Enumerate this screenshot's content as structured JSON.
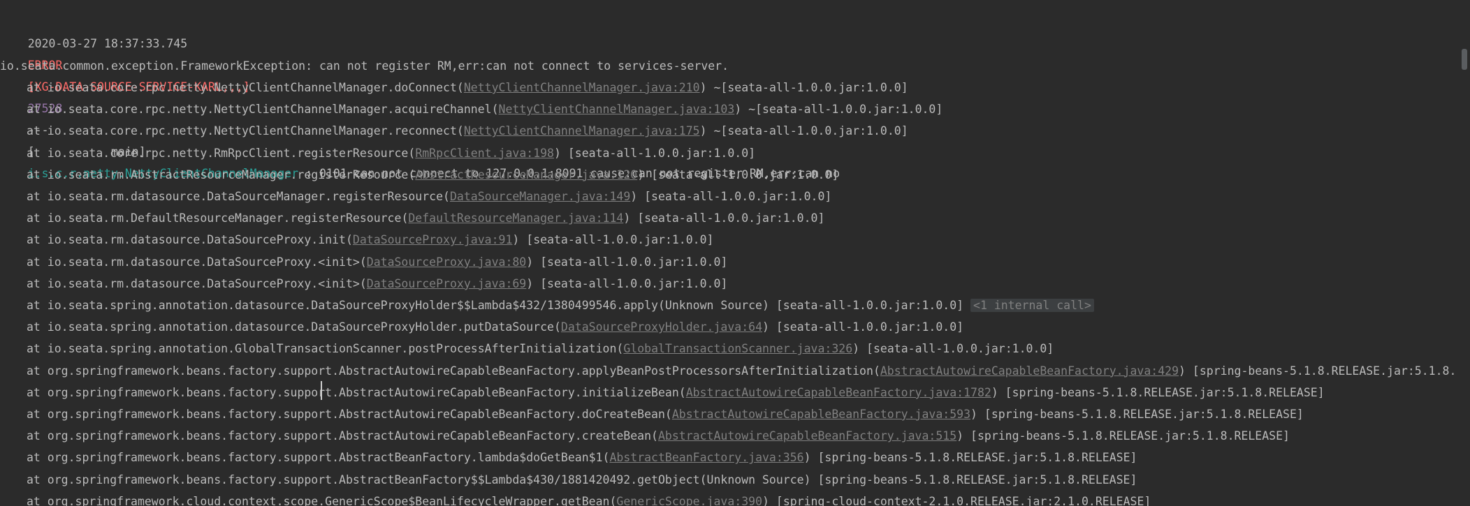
{
  "header_line": {
    "timestamp": "2020-03-27 18:37:33.745",
    "level": "ERROR",
    "app": "[XG-DATA-SOURCE-SERVICE-KARL,,,]",
    "pid": "27528",
    "sep": "---",
    "thread": "[           main]",
    "logger": "i.s.c.r.netty.NettyClientChannelManager",
    "message": " : 0101 can not connect to 127.0.0.1:8091 cause:can not register RM,err:can no"
  },
  "exception": "io.seata.common.exception.FrameworkException: can not register RM,err:can not connect to services-server.",
  "frames": [
    {
      "method": "at io.seata.core.rpc.netty.NettyClientChannelManager.doConnect",
      "source": "NettyClientChannelManager.java:210",
      "jar": " ~[seata-all-1.0.0.jar:1.0.0]",
      "extra": ""
    },
    {
      "method": "at io.seata.core.rpc.netty.NettyClientChannelManager.acquireChannel",
      "source": "NettyClientChannelManager.java:103",
      "jar": " ~[seata-all-1.0.0.jar:1.0.0]",
      "extra": ""
    },
    {
      "method": "at io.seata.core.rpc.netty.NettyClientChannelManager.reconnect",
      "source": "NettyClientChannelManager.java:175",
      "jar": " ~[seata-all-1.0.0.jar:1.0.0]",
      "extra": ""
    },
    {
      "method": "at io.seata.core.rpc.netty.RmRpcClient.registerResource",
      "source": "RmRpcClient.java:198",
      "jar": " [seata-all-1.0.0.jar:1.0.0]",
      "extra": ""
    },
    {
      "method": "at io.seata.rm.AbstractResourceManager.registerResource",
      "source": "AbstractResourceManager.java:120",
      "jar": " [seata-all-1.0.0.jar:1.0.0]",
      "extra": ""
    },
    {
      "method": "at io.seata.rm.datasource.DataSourceManager.registerResource",
      "source": "DataSourceManager.java:149",
      "jar": " [seata-all-1.0.0.jar:1.0.0]",
      "extra": ""
    },
    {
      "method": "at io.seata.rm.DefaultResourceManager.registerResource",
      "source": "DefaultResourceManager.java:114",
      "jar": " [seata-all-1.0.0.jar:1.0.0]",
      "extra": ""
    },
    {
      "method": "at io.seata.rm.datasource.DataSourceProxy.init",
      "source": "DataSourceProxy.java:91",
      "jar": " [seata-all-1.0.0.jar:1.0.0]",
      "extra": ""
    },
    {
      "method": "at io.seata.rm.datasource.DataSourceProxy.<init>",
      "source": "DataSourceProxy.java:80",
      "jar": " [seata-all-1.0.0.jar:1.0.0]",
      "extra": ""
    },
    {
      "method": "at io.seata.rm.datasource.DataSourceProxy.<init>",
      "source": "DataSourceProxy.java:69",
      "jar": " [seata-all-1.0.0.jar:1.0.0]",
      "extra": ""
    },
    {
      "method": "at io.seata.spring.annotation.datasource.DataSourceProxyHolder$$Lambda$432/1380499546.apply(Unknown Source)",
      "source": "",
      "jar": " [seata-all-1.0.0.jar:1.0.0]",
      "extra": "<1 internal call>"
    },
    {
      "method": "at io.seata.spring.annotation.datasource.DataSourceProxyHolder.putDataSource",
      "source": "DataSourceProxyHolder.java:64",
      "jar": " [seata-all-1.0.0.jar:1.0.0]",
      "extra": ""
    },
    {
      "method": "at io.seata.spring.annotation.GlobalTransactionScanner.postProcessAfterInitialization",
      "source": "GlobalTransactionScanner.java:326",
      "jar": " [seata-all-1.0.0.jar:1.0.0]",
      "extra": ""
    },
    {
      "method": "at org.springframework.beans.factory.support.AbstractAutowireCapableBeanFactory.applyBeanPostProcessorsAfterInitialization",
      "source": "AbstractAutowireCapableBeanFactory.java:429",
      "jar": " [spring-beans-5.1.8.RELEASE.jar:5.1.8.",
      "extra": ""
    },
    {
      "method": "at org.springframework.beans.factory.support.AbstractAutowireCapableBeanFactory.initializeBean",
      "source": "AbstractAutowireCapableBeanFactory.java:1782",
      "jar": " [spring-beans-5.1.8.RELEASE.jar:5.1.8.RELEASE]",
      "extra": ""
    },
    {
      "method": "at org.springframework.beans.factory.support.AbstractAutowireCapableBeanFactory.doCreateBean",
      "source": "AbstractAutowireCapableBeanFactory.java:593",
      "jar": " [spring-beans-5.1.8.RELEASE.jar:5.1.8.RELEASE]",
      "extra": ""
    },
    {
      "method": "at org.springframework.beans.factory.support.AbstractAutowireCapableBeanFactory.createBean",
      "source": "AbstractAutowireCapableBeanFactory.java:515",
      "jar": " [spring-beans-5.1.8.RELEASE.jar:5.1.8.RELEASE]",
      "extra": ""
    },
    {
      "method": "at org.springframework.beans.factory.support.AbstractBeanFactory.lambda$doGetBean$1",
      "source": "AbstractBeanFactory.java:356",
      "jar": " [spring-beans-5.1.8.RELEASE.jar:5.1.8.RELEASE]",
      "extra": ""
    },
    {
      "method": "at org.springframework.beans.factory.support.AbstractBeanFactory$$Lambda$430/1881420492.getObject(Unknown Source)",
      "source": "",
      "jar": " [spring-beans-5.1.8.RELEASE.jar:5.1.8.RELEASE]",
      "extra": ""
    },
    {
      "method": "at org.springframework.cloud.context.scope.GenericScope$BeanLifecycleWrapper.getBean",
      "source": "GenericScope.java:390",
      "jar": " [spring-cloud-context-2.1.0.RELEASE.jar:2.1.0.RELEASE]",
      "extra": ""
    }
  ],
  "colors": {
    "background": "#2b2b2b",
    "text": "#bbbbbb",
    "error": "#ff6b68",
    "pid": "#9876aa",
    "logger": "#2aa198",
    "link": "#808080"
  }
}
